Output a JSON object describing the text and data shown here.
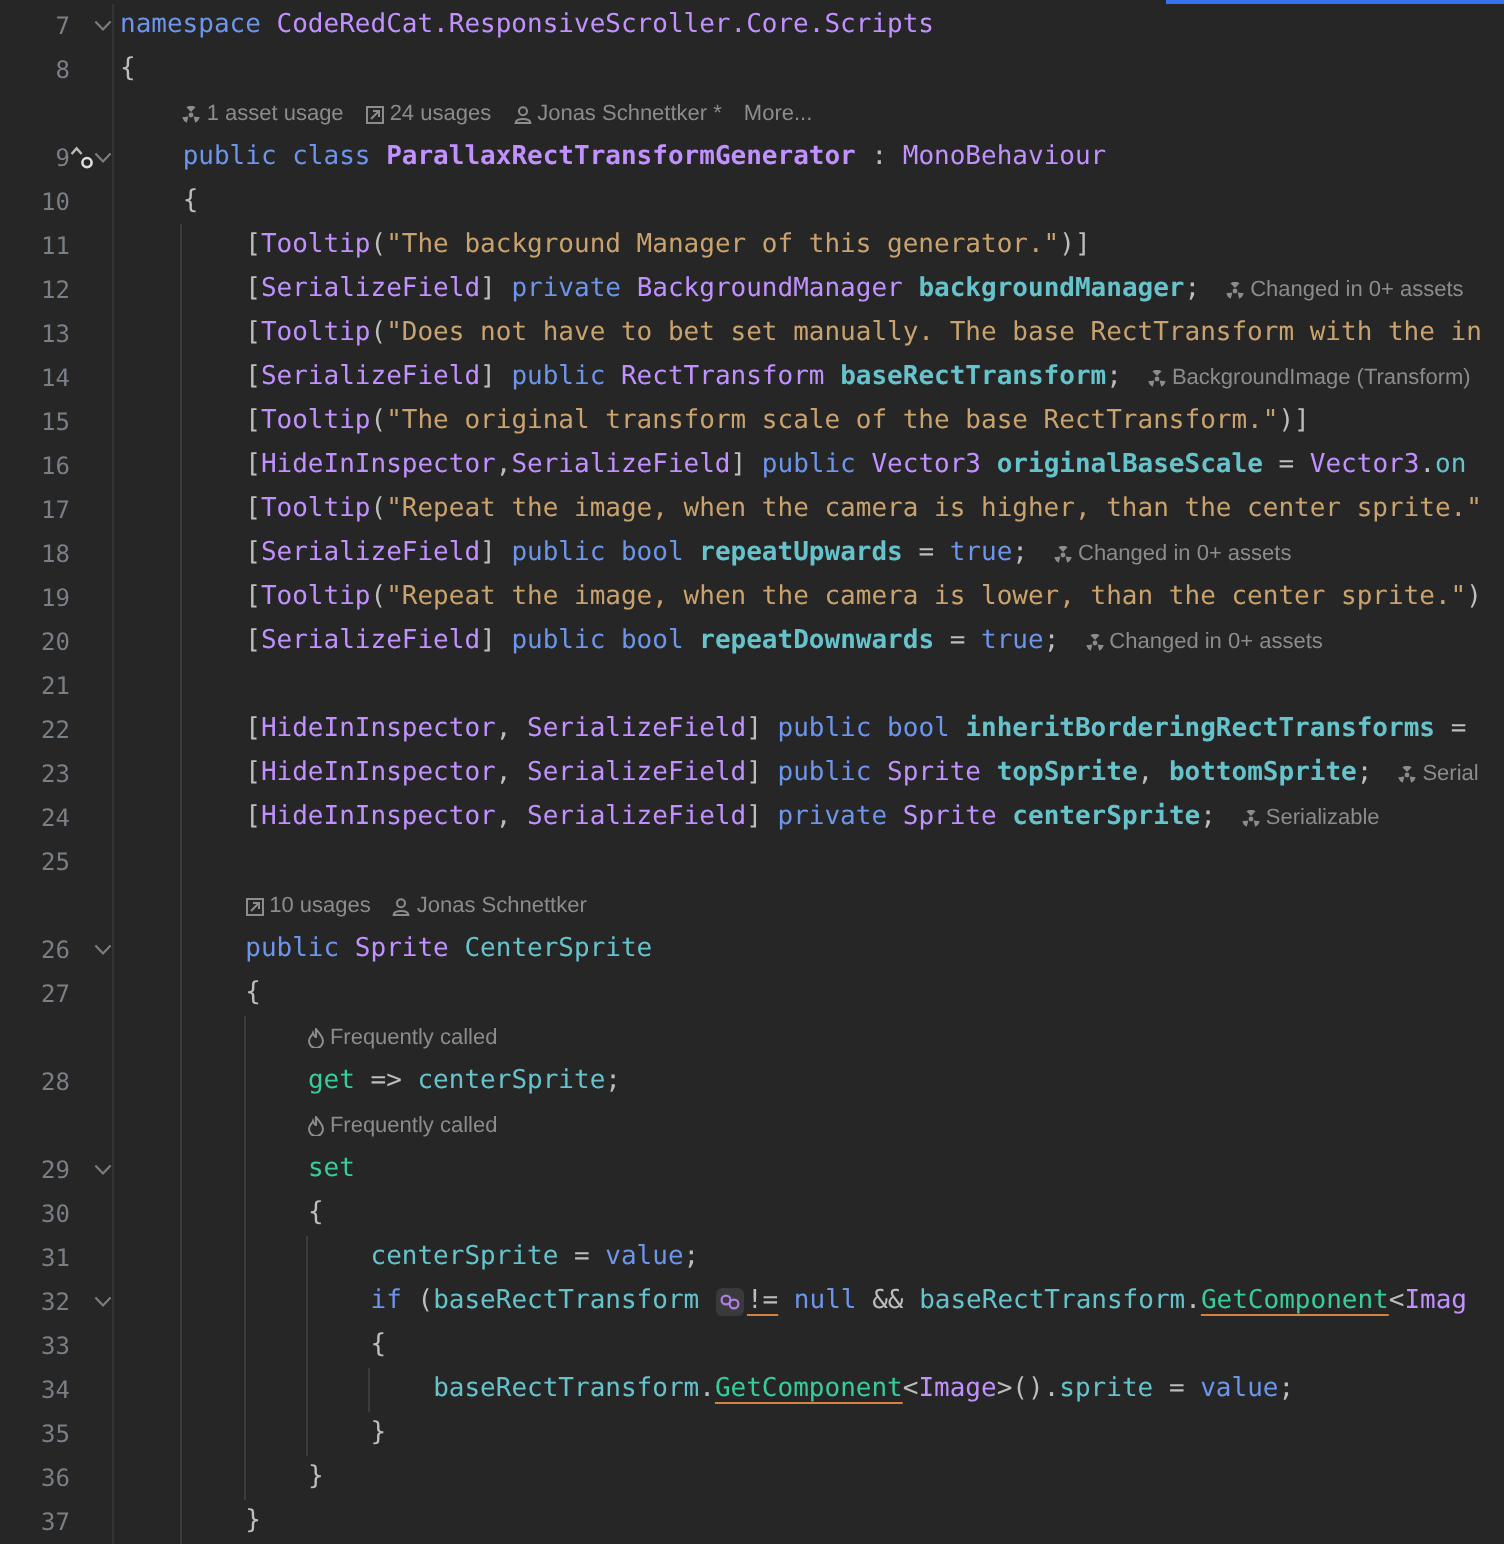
{
  "lines": [
    {
      "kind": "code",
      "number": "7",
      "fold": true,
      "tokens": [
        {
          "text": "namespace ",
          "kind": "kw"
        },
        {
          "text": "CodeRedCat.ResponsiveScroller.Core.Scripts",
          "kind": "type"
        }
      ]
    },
    {
      "kind": "code",
      "number": "8",
      "fold": false,
      "tokens": [
        {
          "text": "{",
          "kind": "plain"
        }
      ]
    },
    {
      "kind": "hints",
      "items": [
        {
          "kind": "asset",
          "text": "1 asset usage"
        },
        {
          "kind": "usages",
          "text": "24 usages"
        },
        {
          "kind": "author",
          "text": "Jonas Schnettker *"
        },
        {
          "kind": "plain",
          "text": "More..."
        }
      ]
    },
    {
      "kind": "code",
      "number": "9",
      "fold": true,
      "gutter_mark": true,
      "tokens": [
        {
          "text": "    public ",
          "kind": "kw"
        },
        {
          "text": "class ",
          "kind": "kw"
        },
        {
          "text": "ParallaxRectTransformGenerator",
          "kind": "type-decl"
        },
        {
          "text": " : ",
          "kind": "plain"
        },
        {
          "text": "MonoBehaviour",
          "kind": "type"
        }
      ]
    },
    {
      "kind": "code",
      "number": "10",
      "fold": false,
      "tokens": [
        {
          "text": "    {",
          "kind": "plain"
        }
      ]
    },
    {
      "kind": "code",
      "number": "11",
      "fold": false,
      "tokens": [
        {
          "text": "        [",
          "kind": "plain"
        },
        {
          "text": "Tooltip",
          "kind": "type"
        },
        {
          "text": "(",
          "kind": "plain"
        },
        {
          "text": "\"The background Manager of this generator.\"",
          "kind": "str"
        },
        {
          "text": ")]",
          "kind": "plain"
        }
      ]
    },
    {
      "kind": "code",
      "number": "12",
      "fold": false,
      "tokens": [
        {
          "text": "        [",
          "kind": "plain"
        },
        {
          "text": "SerializeField",
          "kind": "type"
        },
        {
          "text": "] ",
          "kind": "plain"
        },
        {
          "text": "private ",
          "kind": "kw"
        },
        {
          "text": "BackgroundManager ",
          "kind": "type"
        },
        {
          "text": "backgroundManager",
          "kind": "field-decl"
        },
        {
          "text": ";",
          "kind": "plain"
        }
      ],
      "hint": {
        "kind": "asset",
        "text": "Changed in 0+ assets"
      }
    },
    {
      "kind": "code",
      "number": "13",
      "fold": false,
      "tokens": [
        {
          "text": "        [",
          "kind": "plain"
        },
        {
          "text": "Tooltip",
          "kind": "type"
        },
        {
          "text": "(",
          "kind": "plain"
        },
        {
          "text": "\"Does not have to bet set manually. The base RectTransform with the in",
          "kind": "str"
        }
      ]
    },
    {
      "kind": "code",
      "number": "14",
      "fold": false,
      "tokens": [
        {
          "text": "        [",
          "kind": "plain"
        },
        {
          "text": "SerializeField",
          "kind": "type"
        },
        {
          "text": "] ",
          "kind": "plain"
        },
        {
          "text": "public ",
          "kind": "kw"
        },
        {
          "text": "RectTransform ",
          "kind": "type"
        },
        {
          "text": "baseRectTransform",
          "kind": "field-decl"
        },
        {
          "text": ";",
          "kind": "plain"
        }
      ],
      "hint": {
        "kind": "asset",
        "text": "BackgroundImage (Transform)"
      }
    },
    {
      "kind": "code",
      "number": "15",
      "fold": false,
      "tokens": [
        {
          "text": "        [",
          "kind": "plain"
        },
        {
          "text": "Tooltip",
          "kind": "type"
        },
        {
          "text": "(",
          "kind": "plain"
        },
        {
          "text": "\"The original transform scale of the base RectTransform.\"",
          "kind": "str"
        },
        {
          "text": ")]",
          "kind": "plain"
        }
      ]
    },
    {
      "kind": "code",
      "number": "16",
      "fold": false,
      "tokens": [
        {
          "text": "        [",
          "kind": "plain"
        },
        {
          "text": "HideInInspector",
          "kind": "type"
        },
        {
          "text": ",",
          "kind": "plain"
        },
        {
          "text": "SerializeField",
          "kind": "type"
        },
        {
          "text": "] ",
          "kind": "plain"
        },
        {
          "text": "public ",
          "kind": "kw"
        },
        {
          "text": "Vector3 ",
          "kind": "type"
        },
        {
          "text": "originalBaseScale",
          "kind": "field-decl"
        },
        {
          "text": " = ",
          "kind": "plain"
        },
        {
          "text": "Vector3",
          "kind": "type"
        },
        {
          "text": ".",
          "kind": "plain"
        },
        {
          "text": "on",
          "kind": "field"
        }
      ]
    },
    {
      "kind": "code",
      "number": "17",
      "fold": false,
      "tokens": [
        {
          "text": "        [",
          "kind": "plain"
        },
        {
          "text": "Tooltip",
          "kind": "type"
        },
        {
          "text": "(",
          "kind": "plain"
        },
        {
          "text": "\"Repeat the image, when the camera is higher, than the center sprite.\"",
          "kind": "str"
        }
      ]
    },
    {
      "kind": "code",
      "number": "18",
      "fold": false,
      "tokens": [
        {
          "text": "        [",
          "kind": "plain"
        },
        {
          "text": "SerializeField",
          "kind": "type"
        },
        {
          "text": "] ",
          "kind": "plain"
        },
        {
          "text": "public ",
          "kind": "kw"
        },
        {
          "text": "bool ",
          "kind": "kw"
        },
        {
          "text": "repeatUpwards",
          "kind": "field-decl"
        },
        {
          "text": " = ",
          "kind": "plain"
        },
        {
          "text": "true",
          "kind": "kw"
        },
        {
          "text": ";",
          "kind": "plain"
        }
      ],
      "hint": {
        "kind": "asset",
        "text": "Changed in 0+ assets"
      }
    },
    {
      "kind": "code",
      "number": "19",
      "fold": false,
      "tokens": [
        {
          "text": "        [",
          "kind": "plain"
        },
        {
          "text": "Tooltip",
          "kind": "type"
        },
        {
          "text": "(",
          "kind": "plain"
        },
        {
          "text": "\"Repeat the image, when the camera is lower, than the center sprite.\"",
          "kind": "str"
        },
        {
          "text": ")",
          "kind": "plain"
        }
      ]
    },
    {
      "kind": "code",
      "number": "20",
      "fold": false,
      "tokens": [
        {
          "text": "        [",
          "kind": "plain"
        },
        {
          "text": "SerializeField",
          "kind": "type"
        },
        {
          "text": "] ",
          "kind": "plain"
        },
        {
          "text": "public ",
          "kind": "kw"
        },
        {
          "text": "bool ",
          "kind": "kw"
        },
        {
          "text": "repeatDownwards",
          "kind": "field-decl"
        },
        {
          "text": " = ",
          "kind": "plain"
        },
        {
          "text": "true",
          "kind": "kw"
        },
        {
          "text": ";",
          "kind": "plain"
        }
      ],
      "hint": {
        "kind": "asset",
        "text": "Changed in 0+ assets"
      }
    },
    {
      "kind": "code",
      "number": "21",
      "fold": false
    },
    {
      "kind": "code",
      "number": "22",
      "fold": false,
      "tokens": [
        {
          "text": "        [",
          "kind": "plain"
        },
        {
          "text": "HideInInspector",
          "kind": "type"
        },
        {
          "text": ", ",
          "kind": "plain"
        },
        {
          "text": "SerializeField",
          "kind": "type"
        },
        {
          "text": "] ",
          "kind": "plain"
        },
        {
          "text": "public ",
          "kind": "kw"
        },
        {
          "text": "bool ",
          "kind": "kw"
        },
        {
          "text": "inheritBorderingRectTransforms",
          "kind": "field-decl"
        },
        {
          "text": " =",
          "kind": "plain"
        }
      ]
    },
    {
      "kind": "code",
      "number": "23",
      "fold": false,
      "tokens": [
        {
          "text": "        [",
          "kind": "plain"
        },
        {
          "text": "HideInInspector",
          "kind": "type"
        },
        {
          "text": ", ",
          "kind": "plain"
        },
        {
          "text": "SerializeField",
          "kind": "type"
        },
        {
          "text": "] ",
          "kind": "plain"
        },
        {
          "text": "public ",
          "kind": "kw"
        },
        {
          "text": "Sprite ",
          "kind": "type"
        },
        {
          "text": "topSprite",
          "kind": "field-decl"
        },
        {
          "text": ", ",
          "kind": "plain"
        },
        {
          "text": "bottomSprite",
          "kind": "field-decl"
        },
        {
          "text": ";",
          "kind": "plain"
        }
      ],
      "hint": {
        "kind": "asset",
        "text": "Serial"
      }
    },
    {
      "kind": "code",
      "number": "24",
      "fold": false,
      "tokens": [
        {
          "text": "        [",
          "kind": "plain"
        },
        {
          "text": "HideInInspector",
          "kind": "type"
        },
        {
          "text": ", ",
          "kind": "plain"
        },
        {
          "text": "SerializeField",
          "kind": "type"
        },
        {
          "text": "] ",
          "kind": "plain"
        },
        {
          "text": "private ",
          "kind": "kw"
        },
        {
          "text": "Sprite ",
          "kind": "type"
        },
        {
          "text": "centerSprite",
          "kind": "field-decl"
        },
        {
          "text": ";",
          "kind": "plain"
        }
      ],
      "hint": {
        "kind": "asset",
        "text": "Serializable"
      }
    },
    {
      "kind": "code",
      "number": "25",
      "fold": false
    },
    {
      "kind": "hints",
      "items": [
        {
          "kind": "usages",
          "text": "10 usages"
        },
        {
          "kind": "author",
          "text": "Jonas Schnettker"
        }
      ]
    },
    {
      "kind": "code",
      "number": "26",
      "fold": true,
      "tokens": [
        {
          "text": "        public ",
          "kind": "kw"
        },
        {
          "text": "Sprite ",
          "kind": "type"
        },
        {
          "text": "CenterSprite",
          "kind": "field"
        }
      ]
    },
    {
      "kind": "code",
      "number": "27",
      "fold": false,
      "tokens": [
        {
          "text": "        {",
          "kind": "plain"
        }
      ]
    },
    {
      "kind": "hints",
      "items": [
        {
          "kind": "fire",
          "text": "Frequently called"
        }
      ]
    },
    {
      "kind": "code",
      "number": "28",
      "fold": false,
      "tokens": [
        {
          "text": "            get",
          "kind": "accessor"
        },
        {
          "text": " => ",
          "kind": "plain"
        },
        {
          "text": "centerSprite",
          "kind": "field"
        },
        {
          "text": ";",
          "kind": "plain"
        }
      ]
    },
    {
      "kind": "hints",
      "items": [
        {
          "kind": "fire",
          "text": "Frequently called"
        }
      ]
    },
    {
      "kind": "code",
      "number": "29",
      "fold": true,
      "tokens": [
        {
          "text": "            set",
          "kind": "accessor"
        }
      ]
    },
    {
      "kind": "code",
      "number": "30",
      "fold": false,
      "tokens": [
        {
          "text": "            {",
          "kind": "plain"
        }
      ]
    },
    {
      "kind": "code",
      "number": "31",
      "fold": false,
      "tokens": [
        {
          "text": "                centerSprite",
          "kind": "field"
        },
        {
          "text": " = ",
          "kind": "plain"
        },
        {
          "text": "value",
          "kind": "kw"
        },
        {
          "text": ";",
          "kind": "plain"
        }
      ]
    },
    {
      "kind": "code",
      "number": "32",
      "fold": true,
      "tokens": [
        {
          "text": "                if",
          "kind": "kw"
        },
        {
          "text": " (",
          "kind": "plain"
        },
        {
          "text": "baseRectTransform ",
          "kind": "field"
        },
        {
          "kind": "inlay"
        },
        {
          "text": "!=",
          "kind": "plain",
          "underline": true
        },
        {
          "text": " null",
          "kind": "kw"
        },
        {
          "text": " && ",
          "kind": "plain"
        },
        {
          "text": "baseRectTransform",
          "kind": "field"
        },
        {
          "text": ".",
          "kind": "plain"
        },
        {
          "text": "GetComponent",
          "kind": "method",
          "underline": true
        },
        {
          "text": "<",
          "kind": "plain"
        },
        {
          "text": "Imag",
          "kind": "type"
        }
      ]
    },
    {
      "kind": "code",
      "number": "33",
      "fold": false,
      "tokens": [
        {
          "text": "                {",
          "kind": "plain"
        }
      ]
    },
    {
      "kind": "code",
      "number": "34",
      "fold": false,
      "tokens": [
        {
          "text": "                    baseRectTransform",
          "kind": "field"
        },
        {
          "text": ".",
          "kind": "plain"
        },
        {
          "text": "GetComponent",
          "kind": "method",
          "underline": true
        },
        {
          "text": "<",
          "kind": "plain"
        },
        {
          "text": "Image",
          "kind": "type"
        },
        {
          "text": ">().",
          "kind": "plain"
        },
        {
          "text": "sprite",
          "kind": "field"
        },
        {
          "text": " = ",
          "kind": "plain"
        },
        {
          "text": "value",
          "kind": "kw"
        },
        {
          "text": ";",
          "kind": "plain"
        }
      ]
    },
    {
      "kind": "code",
      "number": "35",
      "fold": false,
      "tokens": [
        {
          "text": "                }",
          "kind": "plain"
        }
      ]
    },
    {
      "kind": "code",
      "number": "36",
      "fold": false,
      "tokens": [
        {
          "text": "            }",
          "kind": "plain"
        }
      ]
    },
    {
      "kind": "code",
      "number": "37",
      "fold": false,
      "tokens": [
        {
          "text": "        }",
          "kind": "plain"
        }
      ]
    }
  ]
}
